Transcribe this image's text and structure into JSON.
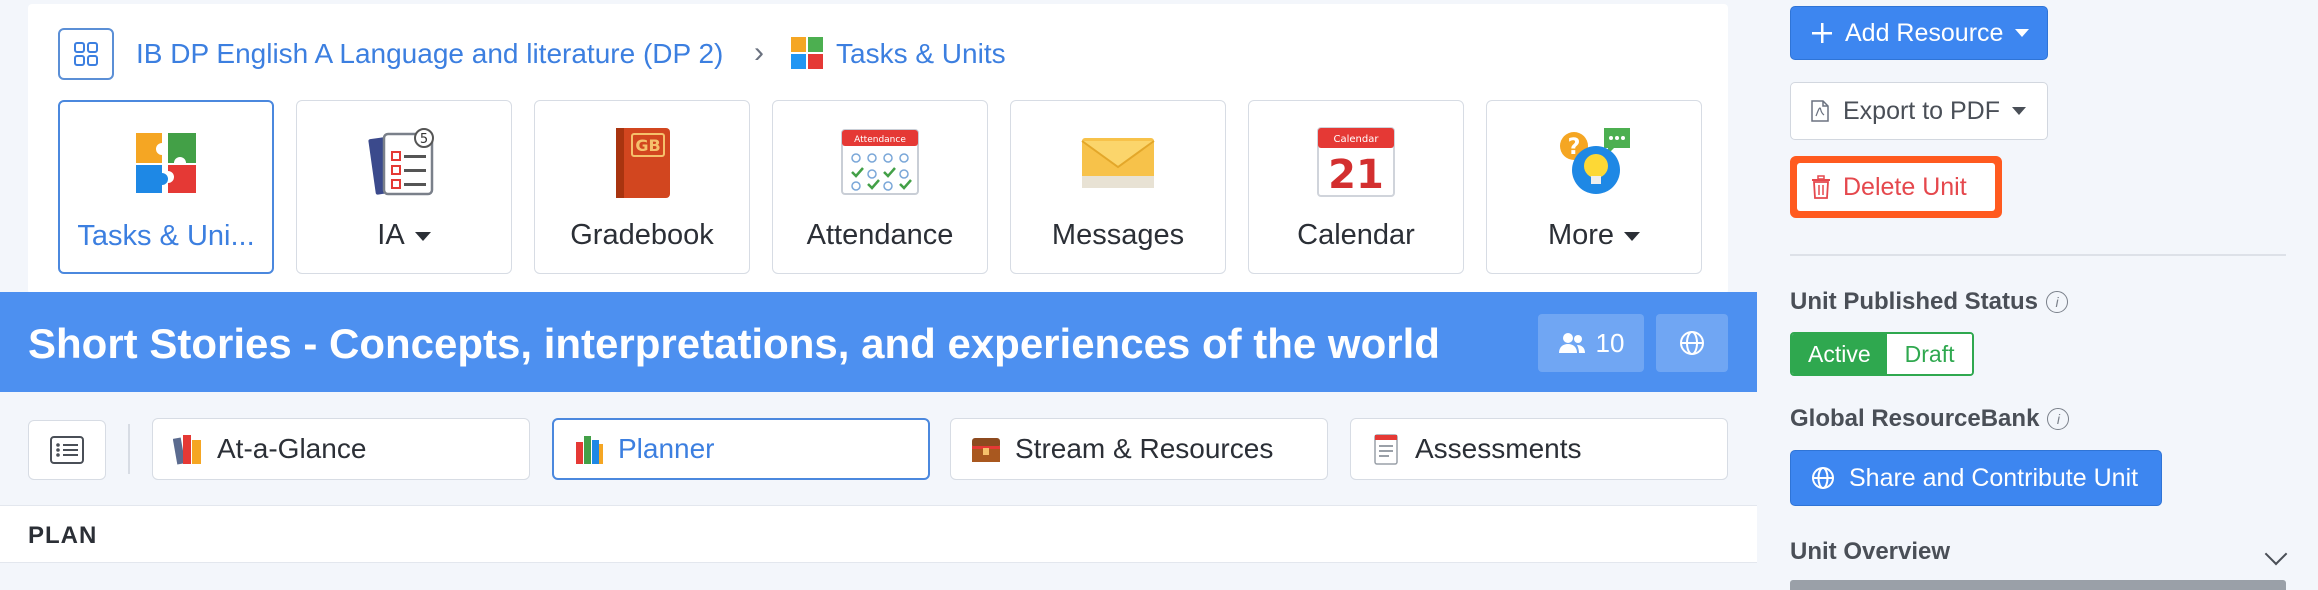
{
  "breadcrumb": {
    "course": "IB DP English A Language and literature (DP 2)",
    "separator": "›",
    "current": "Tasks & Units"
  },
  "tiles": [
    {
      "label": "Tasks & Uni...",
      "icon": "puzzle-icon",
      "active": true,
      "dropdown": false
    },
    {
      "label": "IA",
      "icon": "ia-checklist-icon",
      "active": false,
      "dropdown": true
    },
    {
      "label": "Gradebook",
      "icon": "gradebook-icon",
      "active": false,
      "dropdown": false
    },
    {
      "label": "Attendance",
      "icon": "attendance-icon",
      "active": false,
      "dropdown": false
    },
    {
      "label": "Messages",
      "icon": "envelope-icon",
      "active": false,
      "dropdown": false
    },
    {
      "label": "Calendar",
      "icon": "calendar-icon",
      "active": false,
      "dropdown": false
    },
    {
      "label": "More",
      "icon": "help-bulb-icon",
      "active": false,
      "dropdown": true
    }
  ],
  "icon_text": {
    "gradebook": "GB",
    "attendance": "Attendance",
    "calendar_header": "Calendar",
    "calendar_day": "21",
    "ia_badge": "5",
    "help": "?"
  },
  "unit": {
    "title": "Short Stories - Concepts, interpretations, and experiences of the world",
    "members_count": "10"
  },
  "unit_tabs": [
    {
      "label": "At-a-Glance",
      "icon": "books-icon",
      "active": false
    },
    {
      "label": "Planner",
      "icon": "planner-books-icon",
      "active": true
    },
    {
      "label": "Stream & Resources",
      "icon": "treasure-chest-icon",
      "active": false
    },
    {
      "label": "Assessments",
      "icon": "notepad-icon",
      "active": false
    }
  ],
  "plan_label": "PLAN",
  "sidebar": {
    "add_resource": "Add Resource",
    "export_pdf": "Export to PDF",
    "delete_unit": "Delete Unit",
    "published_label": "Unit Published Status",
    "status_active": "Active",
    "status_draft": "Draft",
    "resourcebank_label": "Global ResourceBank",
    "share_button": "Share and Contribute Unit",
    "overview_label": "Unit Overview",
    "info_glyph": "i"
  },
  "colors": {
    "accent": "#3d86f0",
    "banner": "#4d90f0",
    "success": "#2fa84f",
    "danger": "#e5484d",
    "highlight": "#ff5a1f"
  }
}
